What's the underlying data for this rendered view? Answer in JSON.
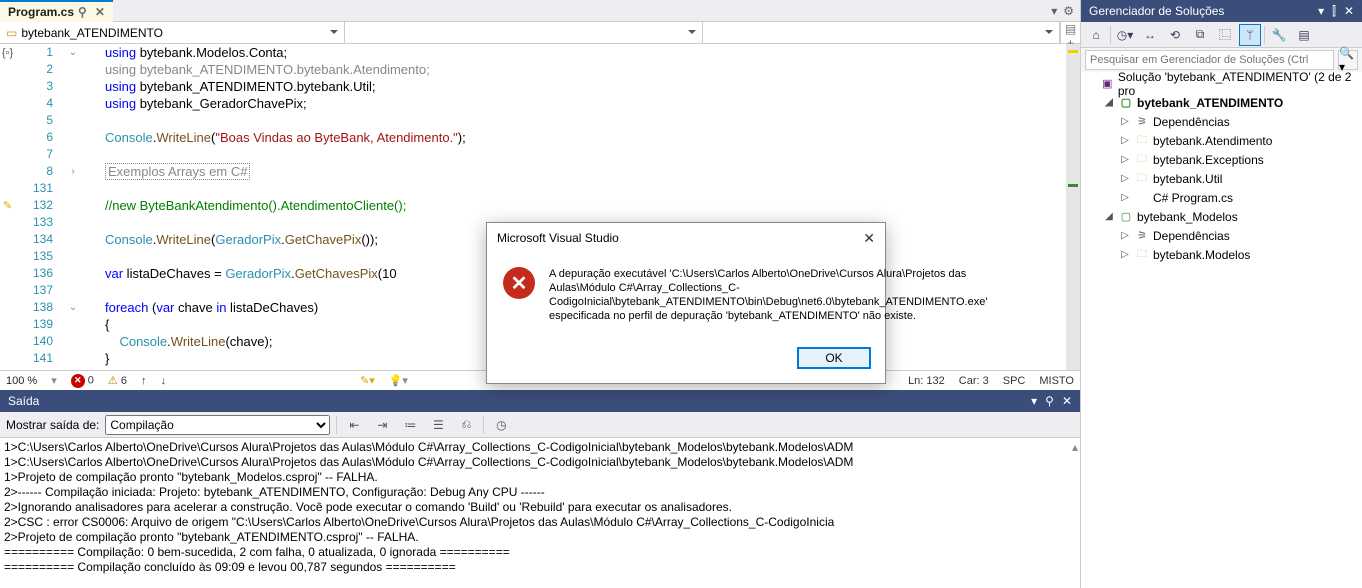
{
  "tab": {
    "title": "Program.cs",
    "pin": "📌",
    "close": "✕"
  },
  "context": {
    "namespace": "bytebank_ATENDIMENTO"
  },
  "code": {
    "lines": [
      {
        "n": "1",
        "fold": "⌄",
        "html": "<span class='kw'>using</span> bytebank.Modelos.Conta;"
      },
      {
        "n": "2",
        "fold": "",
        "html": "<span class='kw dim'>using</span> <span class='dim'>bytebank_ATENDIMENTO.bytebank.Atendimento;</span>"
      },
      {
        "n": "3",
        "fold": "",
        "html": "<span class='kw'>using</span> bytebank_ATENDIMENTO.bytebank.Util;"
      },
      {
        "n": "4",
        "fold": "",
        "html": "<span class='kw'>using</span> bytebank_GeradorChavePix;"
      },
      {
        "n": "5",
        "fold": "",
        "html": ""
      },
      {
        "n": "6",
        "fold": "",
        "html": "<span class='cls'>Console</span>.<span class='mth'>WriteLine</span>(<span class='str'>\"Boas Vindas ao ByteBank, Atendimento.\"</span>);"
      },
      {
        "n": "7",
        "fold": "",
        "html": ""
      },
      {
        "n": "8",
        "fold": "›",
        "html": "<span class='boxed dim'>Exemplos Arrays em C#</span>"
      },
      {
        "n": "131",
        "fold": "",
        "html": ""
      },
      {
        "n": "132",
        "fold": "",
        "html": "<span class='com'>//new ByteBankAtendimento().AtendimentoCliente();</span>",
        "brush": true
      },
      {
        "n": "133",
        "fold": "",
        "html": ""
      },
      {
        "n": "134",
        "fold": "",
        "html": "<span class='cls'>Console</span>.<span class='mth'>WriteLine</span>(<span class='cls'>GeradorPix</span>.<span class='mth'>GetChavePix</span>());"
      },
      {
        "n": "135",
        "fold": "",
        "html": ""
      },
      {
        "n": "136",
        "fold": "",
        "html": "<span class='kw'>var</span> listaDeChaves = <span class='cls'>GeradorPix</span>.<span class='mth'>GetChavesPix</span>(10"
      },
      {
        "n": "137",
        "fold": "",
        "html": ""
      },
      {
        "n": "138",
        "fold": "⌄",
        "html": "<span class='kw'>foreach</span> (<span class='kw'>var</span> chave <span class='kw'>in</span> listaDeChaves)"
      },
      {
        "n": "139",
        "fold": "",
        "html": "{"
      },
      {
        "n": "140",
        "fold": "",
        "html": "    <span class='cls'>Console</span>.<span class='mth'>WriteLine</span>(chave);"
      },
      {
        "n": "141",
        "fold": "",
        "html": "}"
      }
    ]
  },
  "status": {
    "zoom": "100 %",
    "errors": "0",
    "warnings": "6",
    "ln": "Ln: 132",
    "car": "Car: 3",
    "spc": "SPC",
    "misto": "MISTO"
  },
  "output": {
    "panel_title": "Saída",
    "label": "Mostrar saída de:",
    "source": "Compilação",
    "lines": [
      "1>C:\\Users\\Carlos Alberto\\OneDrive\\Cursos Alura\\Projetos das Aulas\\Módulo C#\\Array_Collections_C-CodigoInicial\\bytebank_Modelos\\bytebank.Modelos\\ADM",
      "1>C:\\Users\\Carlos Alberto\\OneDrive\\Cursos Alura\\Projetos das Aulas\\Módulo C#\\Array_Collections_C-CodigoInicial\\bytebank_Modelos\\bytebank.Modelos\\ADM",
      "1>Projeto de compilação pronto \"bytebank_Modelos.csproj\" -- FALHA.",
      "2>------ Compilação iniciada: Projeto: bytebank_ATENDIMENTO, Configuração: Debug Any CPU ------",
      "2>Ignorando analisadores para acelerar a construção. Você pode executar o comando 'Build' ou 'Rebuild' para executar os analisadores.",
      "2>CSC : error CS0006: Arquivo de origem \"C:\\Users\\Carlos Alberto\\OneDrive\\Cursos Alura\\Projetos das Aulas\\Módulo C#\\Array_Collections_C-CodigoInicia",
      "2>Projeto de compilação pronto \"bytebank_ATENDIMENTO.csproj\" -- FALHA.",
      "========== Compilação: 0 bem-sucedida, 2 com falha, 0 atualizada, 0 ignorada ==========",
      "========== Compilação concluído às 09:09 e levou 00,787 segundos =========="
    ]
  },
  "solution": {
    "title": "Gerenciador de Soluções",
    "search_placeholder": "Pesquisar em Gerenciador de Soluções (Ctrl",
    "root": "Solução 'bytebank_ATENDIMENTO' (2 de 2 pro",
    "nodes": [
      {
        "depth": 1,
        "arrow": "◢",
        "ico": "proj",
        "label": "bytebank_ATENDIMENTO",
        "bold": true
      },
      {
        "depth": 2,
        "arrow": "▷",
        "ico": "dep",
        "label": "Dependências"
      },
      {
        "depth": 2,
        "arrow": "▷",
        "ico": "folder",
        "label": "bytebank.Atendimento"
      },
      {
        "depth": 2,
        "arrow": "▷",
        "ico": "folder",
        "label": "bytebank.Exceptions"
      },
      {
        "depth": 2,
        "arrow": "▷",
        "ico": "folder",
        "label": "bytebank.Util"
      },
      {
        "depth": 2,
        "arrow": "▷",
        "ico": "cs",
        "label": "C# Program.cs"
      },
      {
        "depth": 1,
        "arrow": "◢",
        "ico": "proj",
        "label": "bytebank_Modelos"
      },
      {
        "depth": 2,
        "arrow": "▷",
        "ico": "dep",
        "label": "Dependências"
      },
      {
        "depth": 2,
        "arrow": "▷",
        "ico": "folder",
        "label": "bytebank.Modelos"
      }
    ]
  },
  "dialog": {
    "title": "Microsoft Visual Studio",
    "text": "A depuração executável 'C:\\Users\\Carlos Alberto\\OneDrive\\Cursos Alura\\Projetos das Aulas\\Módulo C#\\Array_Collections_C-CodigoInicial\\bytebank_ATENDIMENTO\\bin\\Debug\\net6.0\\bytebank_ATENDIMENTO.exe' especificada no perfil de depuração 'bytebank_ATENDIMENTO' não existe.",
    "ok": "OK"
  }
}
